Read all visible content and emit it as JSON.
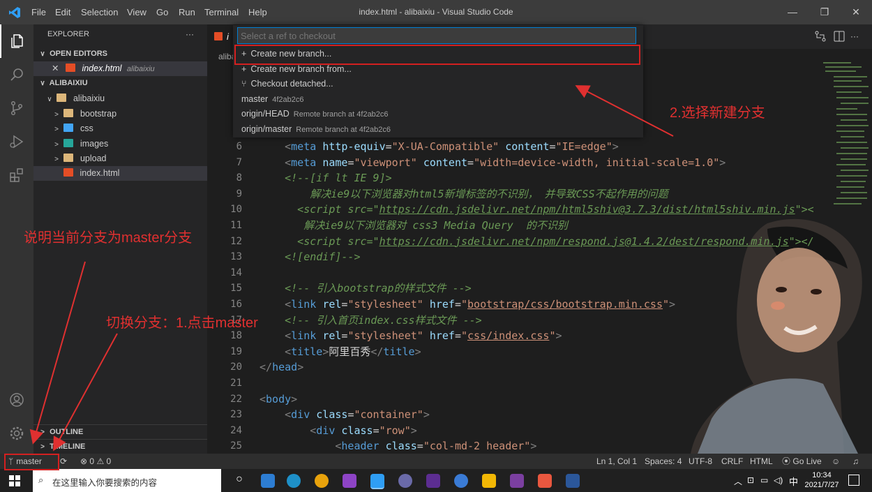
{
  "window": {
    "title": "index.html - alibaixiu - Visual Studio Code",
    "menu": [
      "File",
      "Edit",
      "Selection",
      "View",
      "Go",
      "Run",
      "Terminal",
      "Help"
    ]
  },
  "sidebar": {
    "explorer_title": "EXPLORER",
    "more": "···",
    "open_editors": "OPEN EDITORS",
    "open_file": "index.html",
    "open_file_folder": "alibaixiu",
    "root": "ALIBAIXIU",
    "folder": "alibaixiu",
    "items": [
      "bootstrap",
      "css",
      "images",
      "upload",
      "index.html"
    ],
    "outline": "OUTLINE",
    "timeline": "TIMELINE"
  },
  "editor": {
    "tab_label": "i",
    "breadcrumb": "aliba",
    "lines": [
      {
        "n": "6",
        "html": "    <span class='p'>&lt;</span><span class='t'>meta</span> <span class='a'>http-equiv</span>=<span class='s'>\"X-UA-Compatible\"</span> <span class='a'>content</span>=<span class='s'>\"IE=edge\"</span><span class='p'>&gt;</span>"
      },
      {
        "n": "7",
        "html": "    <span class='p'>&lt;</span><span class='t'>meta</span> <span class='a'>name</span>=<span class='s'>\"viewport\"</span> <span class='a'>content</span>=<span class='s'>\"width=device-width, initial-scale=1.0\"</span><span class='p'>&gt;</span>"
      },
      {
        "n": "8",
        "html": "    <span class='c'>&lt;!--[if lt IE 9]&gt;</span>"
      },
      {
        "n": "9",
        "html": "<span class='c'>        解决ie9以下浏览器对html5新增标签的不识别， 并导致CSS不起作用的问题</span>"
      },
      {
        "n": "10",
        "html": "<span class='c'>      &lt;script src=\"<span class='u'>https://cdn.jsdelivr.net/npm/html5shiv@3.7.3/dist/html5shiv.min.js</span>\"&gt;&lt;</span>"
      },
      {
        "n": "11",
        "html": "<span class='c'>       解决ie9以下浏览器对 css3 Media Query  的不识别</span>"
      },
      {
        "n": "12",
        "html": "<span class='c'>      &lt;script src=\"<span class='u'>https://cdn.jsdelivr.net/npm/respond.js@1.4.2/dest/respond.min.js</span>\"&gt;&lt;/</span>"
      },
      {
        "n": "13",
        "html": "<span class='c'>    &lt;![endif]--&gt;</span>"
      },
      {
        "n": "14",
        "html": ""
      },
      {
        "n": "15",
        "html": "    <span class='c'>&lt;!-- 引入bootstrap的样式文件 --&gt;</span>"
      },
      {
        "n": "16",
        "html": "    <span class='p'>&lt;</span><span class='t'>link</span> <span class='a'>rel</span>=<span class='s'>\"stylesheet\"</span> <span class='a'>href</span>=<span class='s'>\"<span class='u'>bootstrap/css/bootstrap.min.css</span>\"</span><span class='p'>&gt;</span>"
      },
      {
        "n": "17",
        "html": "    <span class='c'>&lt;!-- 引入首页index.css样式文件 --&gt;</span>"
      },
      {
        "n": "18",
        "html": "    <span class='p'>&lt;</span><span class='t'>link</span> <span class='a'>rel</span>=<span class='s'>\"stylesheet\"</span> <span class='a'>href</span>=<span class='s'>\"<span class='u'>css/index.css</span>\"</span><span class='p'>&gt;</span>"
      },
      {
        "n": "19",
        "html": "    <span class='p'>&lt;</span><span class='t'>title</span><span class='p'>&gt;</span>阿里百秀<span class='p'>&lt;/</span><span class='t'>title</span><span class='p'>&gt;</span>"
      },
      {
        "n": "20",
        "html": "<span class='p'>&lt;/</span><span class='t'>head</span><span class='p'>&gt;</span>"
      },
      {
        "n": "21",
        "html": ""
      },
      {
        "n": "22",
        "html": "<span class='p'>&lt;</span><span class='t'>body</span><span class='p'>&gt;</span>"
      },
      {
        "n": "23",
        "html": "    <span class='p'>&lt;</span><span class='t'>div</span> <span class='a'>class</span>=<span class='s'>\"container\"</span><span class='p'>&gt;</span>"
      },
      {
        "n": "24",
        "html": "        <span class='p'>&lt;</span><span class='t'>div</span> <span class='a'>class</span>=<span class='s'>\"row\"</span><span class='p'>&gt;</span>"
      },
      {
        "n": "25",
        "html": "            <span class='p'>&lt;</span><span class='t'>header</span> <span class='a'>class</span>=<span class='s'>\"col-md-2 header\"</span><span class='p'>&gt;</span>"
      }
    ]
  },
  "quickpick": {
    "placeholder": "Select a ref to checkout",
    "items": [
      {
        "icon": "+",
        "label": "Create new branch...",
        "desc": ""
      },
      {
        "icon": "+",
        "label": "Create new branch from...",
        "desc": ""
      },
      {
        "icon": "⑂",
        "label": "Checkout detached...",
        "desc": ""
      },
      {
        "icon": "",
        "label": "master",
        "desc": "4f2ab2c6"
      },
      {
        "icon": "",
        "label": "origin/HEAD",
        "desc": "Remote branch at 4f2ab2c6"
      },
      {
        "icon": "",
        "label": "origin/master",
        "desc": "Remote branch at 4f2ab2c6"
      }
    ]
  },
  "statusbar": {
    "branch": "master",
    "errors": "0",
    "warnings": "0",
    "position": "Ln 1, Col 1",
    "spaces": "Spaces: 4",
    "encoding": "UTF-8",
    "eol": "CRLF",
    "language": "HTML",
    "golive": "Go Live"
  },
  "taskbar": {
    "search_placeholder": "在这里输入你要搜索的内容",
    "ime": "中",
    "time": "10:34",
    "date": "2021/7/27"
  },
  "annotations": {
    "step2": "2.选择新建分支",
    "current_branch": "说明当前分支为master分支",
    "step1": "切换分支：1.点击master"
  },
  "colors": {
    "annotation": "#e03030",
    "accent": "#007fd4",
    "statusbar": "#2e2e2e"
  }
}
